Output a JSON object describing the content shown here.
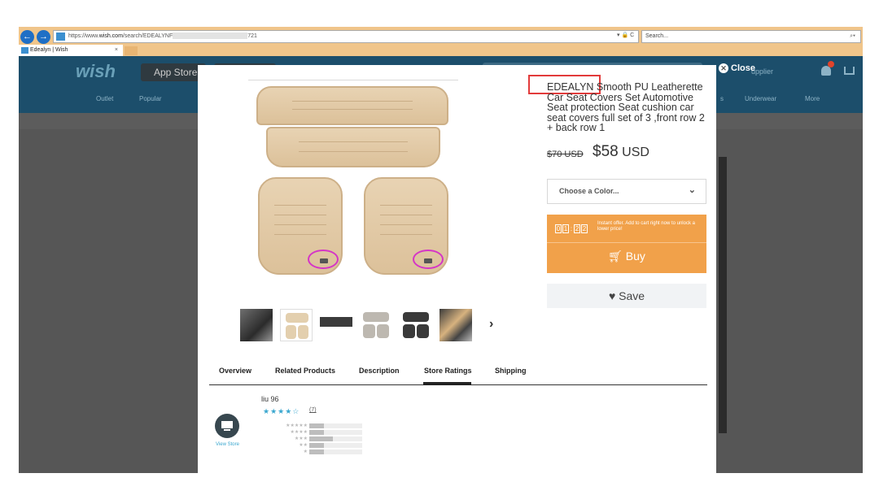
{
  "browser": {
    "url_prefix": "https://www.",
    "url_domain": "wish.com",
    "url_path": "/search/EDEALYNF",
    "url_tail": "721",
    "search_placeholder": "Search...",
    "tab_title": "Edealyn | Wish",
    "tab_close": "×",
    "back_icon": "arrow-left-icon",
    "forward_icon": "arrow-right-icon",
    "addr_tools": "▾ 🔒 C"
  },
  "site": {
    "logo": "wish",
    "app_store_label": "App Store",
    "nav": [
      "Outlet",
      "Popular",
      "s",
      "Underwear",
      "More"
    ],
    "header_right": "upplier"
  },
  "modal": {
    "close_label": "Close",
    "title_brand": "EDEALYN",
    "title_rest": " Smooth PU Leatherette Car Seat Covers Set Automotive Seat protection Seat cushion car seat covers full set of 3 ,front row 2 + back row 1",
    "old_price": "$70 USD",
    "new_price_amount": "$58",
    "new_price_currency": " USD",
    "color_select_placeholder": "Choose a Color...",
    "timer_digits": [
      "0",
      "1",
      "2",
      "2"
    ],
    "offer_text": "Instant offer. Add to cart right now to unlock a lower price!",
    "buy_label": "Buy",
    "save_label": "♥ Save",
    "tabs": [
      "Overview",
      "Related Products",
      "Description",
      "Store Ratings",
      "Shipping"
    ],
    "active_tab": "Store Ratings",
    "review_user": "liu        96",
    "review_stars": "★★★★☆",
    "review_count": "(7)",
    "view_store_label": "View Store",
    "rating_rows": [
      {
        "stars": "★★★★★",
        "fill": 0.28
      },
      {
        "stars": "★★★★",
        "fill": 0.28
      },
      {
        "stars": "★★★",
        "fill": 0.45
      },
      {
        "stars": "★★",
        "fill": 0.28
      },
      {
        "stars": "★",
        "fill": 0.28
      }
    ],
    "next_arrow": "›"
  },
  "colors": {
    "wish_header": "#1c4e6b",
    "offer_orange": "#f1a14a",
    "highlight_red": "#e23b3b",
    "highlight_magenta": "#d535c6",
    "star_blue": "#3aa7cf"
  }
}
